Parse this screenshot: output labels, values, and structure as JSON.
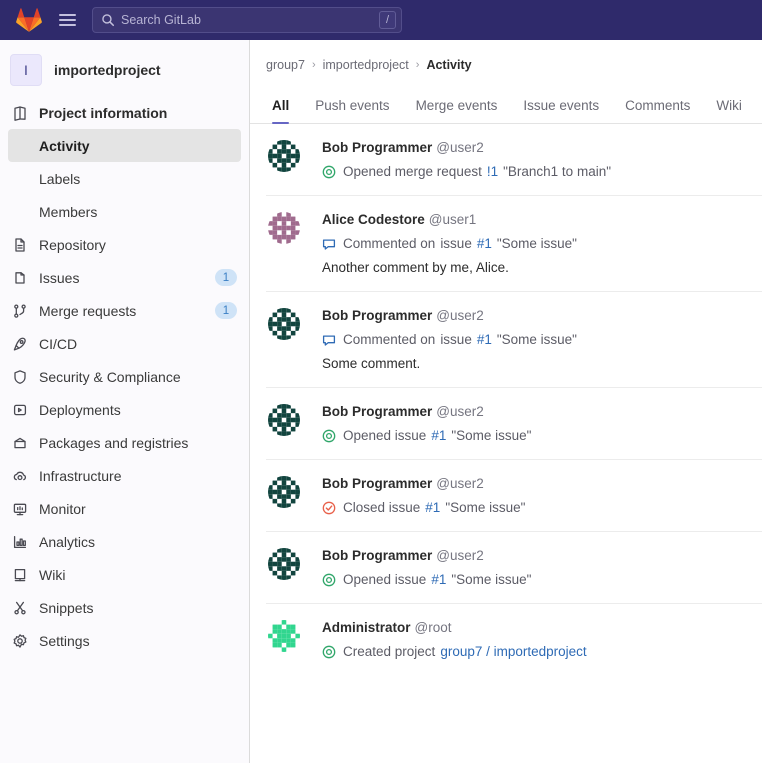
{
  "topnav": {
    "logo_icon": "gitlab-logo-icon",
    "menu_icon": "hamburger-menu-icon",
    "search": {
      "icon": "search-icon",
      "value": "",
      "placeholder": "Search GitLab",
      "shortcut_key": "/"
    }
  },
  "sidebar": {
    "project": {
      "initial": "I",
      "name": "importedproject"
    },
    "items": [
      {
        "label": "Project information",
        "icon": "project-information-icon",
        "strong": true,
        "badge": null
      },
      {
        "label": "Activity",
        "sub": true,
        "active": true,
        "icon": null,
        "badge": null
      },
      {
        "label": "Labels",
        "sub": true,
        "active": false,
        "icon": null,
        "badge": null
      },
      {
        "label": "Members",
        "sub": true,
        "active": false,
        "icon": null,
        "badge": null
      },
      {
        "label": "Repository",
        "icon": "repository-icon",
        "badge": null
      },
      {
        "label": "Issues",
        "icon": "issues-icon",
        "badge": "1"
      },
      {
        "label": "Merge requests",
        "icon": "merge-requests-icon",
        "badge": "1"
      },
      {
        "label": "CI/CD",
        "icon": "rocket-icon",
        "badge": null
      },
      {
        "label": "Security & Compliance",
        "icon": "shield-icon",
        "badge": null
      },
      {
        "label": "Deployments",
        "icon": "deployments-icon",
        "badge": null
      },
      {
        "label": "Packages and registries",
        "icon": "package-icon",
        "badge": null
      },
      {
        "label": "Infrastructure",
        "icon": "cloud-gear-icon",
        "badge": null
      },
      {
        "label": "Monitor",
        "icon": "monitor-icon",
        "badge": null
      },
      {
        "label": "Analytics",
        "icon": "analytics-chart-icon",
        "badge": null
      },
      {
        "label": "Wiki",
        "icon": "book-icon",
        "badge": null
      },
      {
        "label": "Snippets",
        "icon": "scissors-icon",
        "badge": null
      },
      {
        "label": "Settings",
        "icon": "gear-icon",
        "badge": null
      }
    ]
  },
  "main": {
    "breadcrumb": [
      {
        "label": "group7",
        "current": false
      },
      {
        "label": "importedproject",
        "current": false
      },
      {
        "label": "Activity",
        "current": true
      }
    ],
    "breadcrumb_separator": "›",
    "tabs": [
      {
        "label": "All",
        "active": true
      },
      {
        "label": "Push events",
        "active": false
      },
      {
        "label": "Merge events",
        "active": false
      },
      {
        "label": "Issue events",
        "active": false
      },
      {
        "label": "Comments",
        "active": false
      },
      {
        "label": "Wiki",
        "active": false
      }
    ],
    "events": [
      {
        "author": "Bob Programmer",
        "handle": "@user2",
        "avatar": "identicon-teal",
        "status_icon": "issue-open-icon",
        "action": "Opened merge request",
        "target": "",
        "reference": "!1",
        "title": "\"Branch1 to main\"",
        "note": "",
        "link": ""
      },
      {
        "author": "Alice Codestore",
        "handle": "@user1",
        "avatar": "identicon-mauve",
        "status_icon": "comment-icon",
        "action": "Commented on",
        "target": "issue",
        "reference": "#1",
        "title": "\"Some issue\"",
        "note": "Another comment by me, Alice.",
        "link": ""
      },
      {
        "author": "Bob Programmer",
        "handle": "@user2",
        "avatar": "identicon-teal",
        "status_icon": "comment-icon",
        "action": "Commented on",
        "target": "issue",
        "reference": "#1",
        "title": "\"Some issue\"",
        "note": "Some comment.",
        "link": ""
      },
      {
        "author": "Bob Programmer",
        "handle": "@user2",
        "avatar": "identicon-teal",
        "status_icon": "issue-open-icon",
        "action": "Opened issue",
        "target": "",
        "reference": "#1",
        "title": "\"Some issue\"",
        "note": "",
        "link": ""
      },
      {
        "author": "Bob Programmer",
        "handle": "@user2",
        "avatar": "identicon-teal",
        "status_icon": "issue-closed-icon",
        "action": "Closed issue",
        "target": "",
        "reference": "#1",
        "title": "\"Some issue\"",
        "note": "",
        "link": ""
      },
      {
        "author": "Bob Programmer",
        "handle": "@user2",
        "avatar": "identicon-teal",
        "status_icon": "issue-open-icon",
        "action": "Opened issue",
        "target": "",
        "reference": "#1",
        "title": "\"Some issue\"",
        "note": "",
        "link": ""
      },
      {
        "author": "Administrator",
        "handle": "@root",
        "avatar": "identicon-green",
        "status_icon": "issue-open-icon",
        "action": "Created project",
        "target": "",
        "reference": "",
        "title": "",
        "note": "",
        "link": "group7 / importedproject"
      }
    ]
  },
  "colors": {
    "navbar_bg": "#2f2a6b",
    "accent": "#6666c4",
    "link": "#2f6bb5",
    "open_green": "#30a66a",
    "closed_red": "#e8604a",
    "comment_blue": "#2f6bb5",
    "badge_bg": "#cfe3f7",
    "badge_text": "#3a7fc4"
  }
}
